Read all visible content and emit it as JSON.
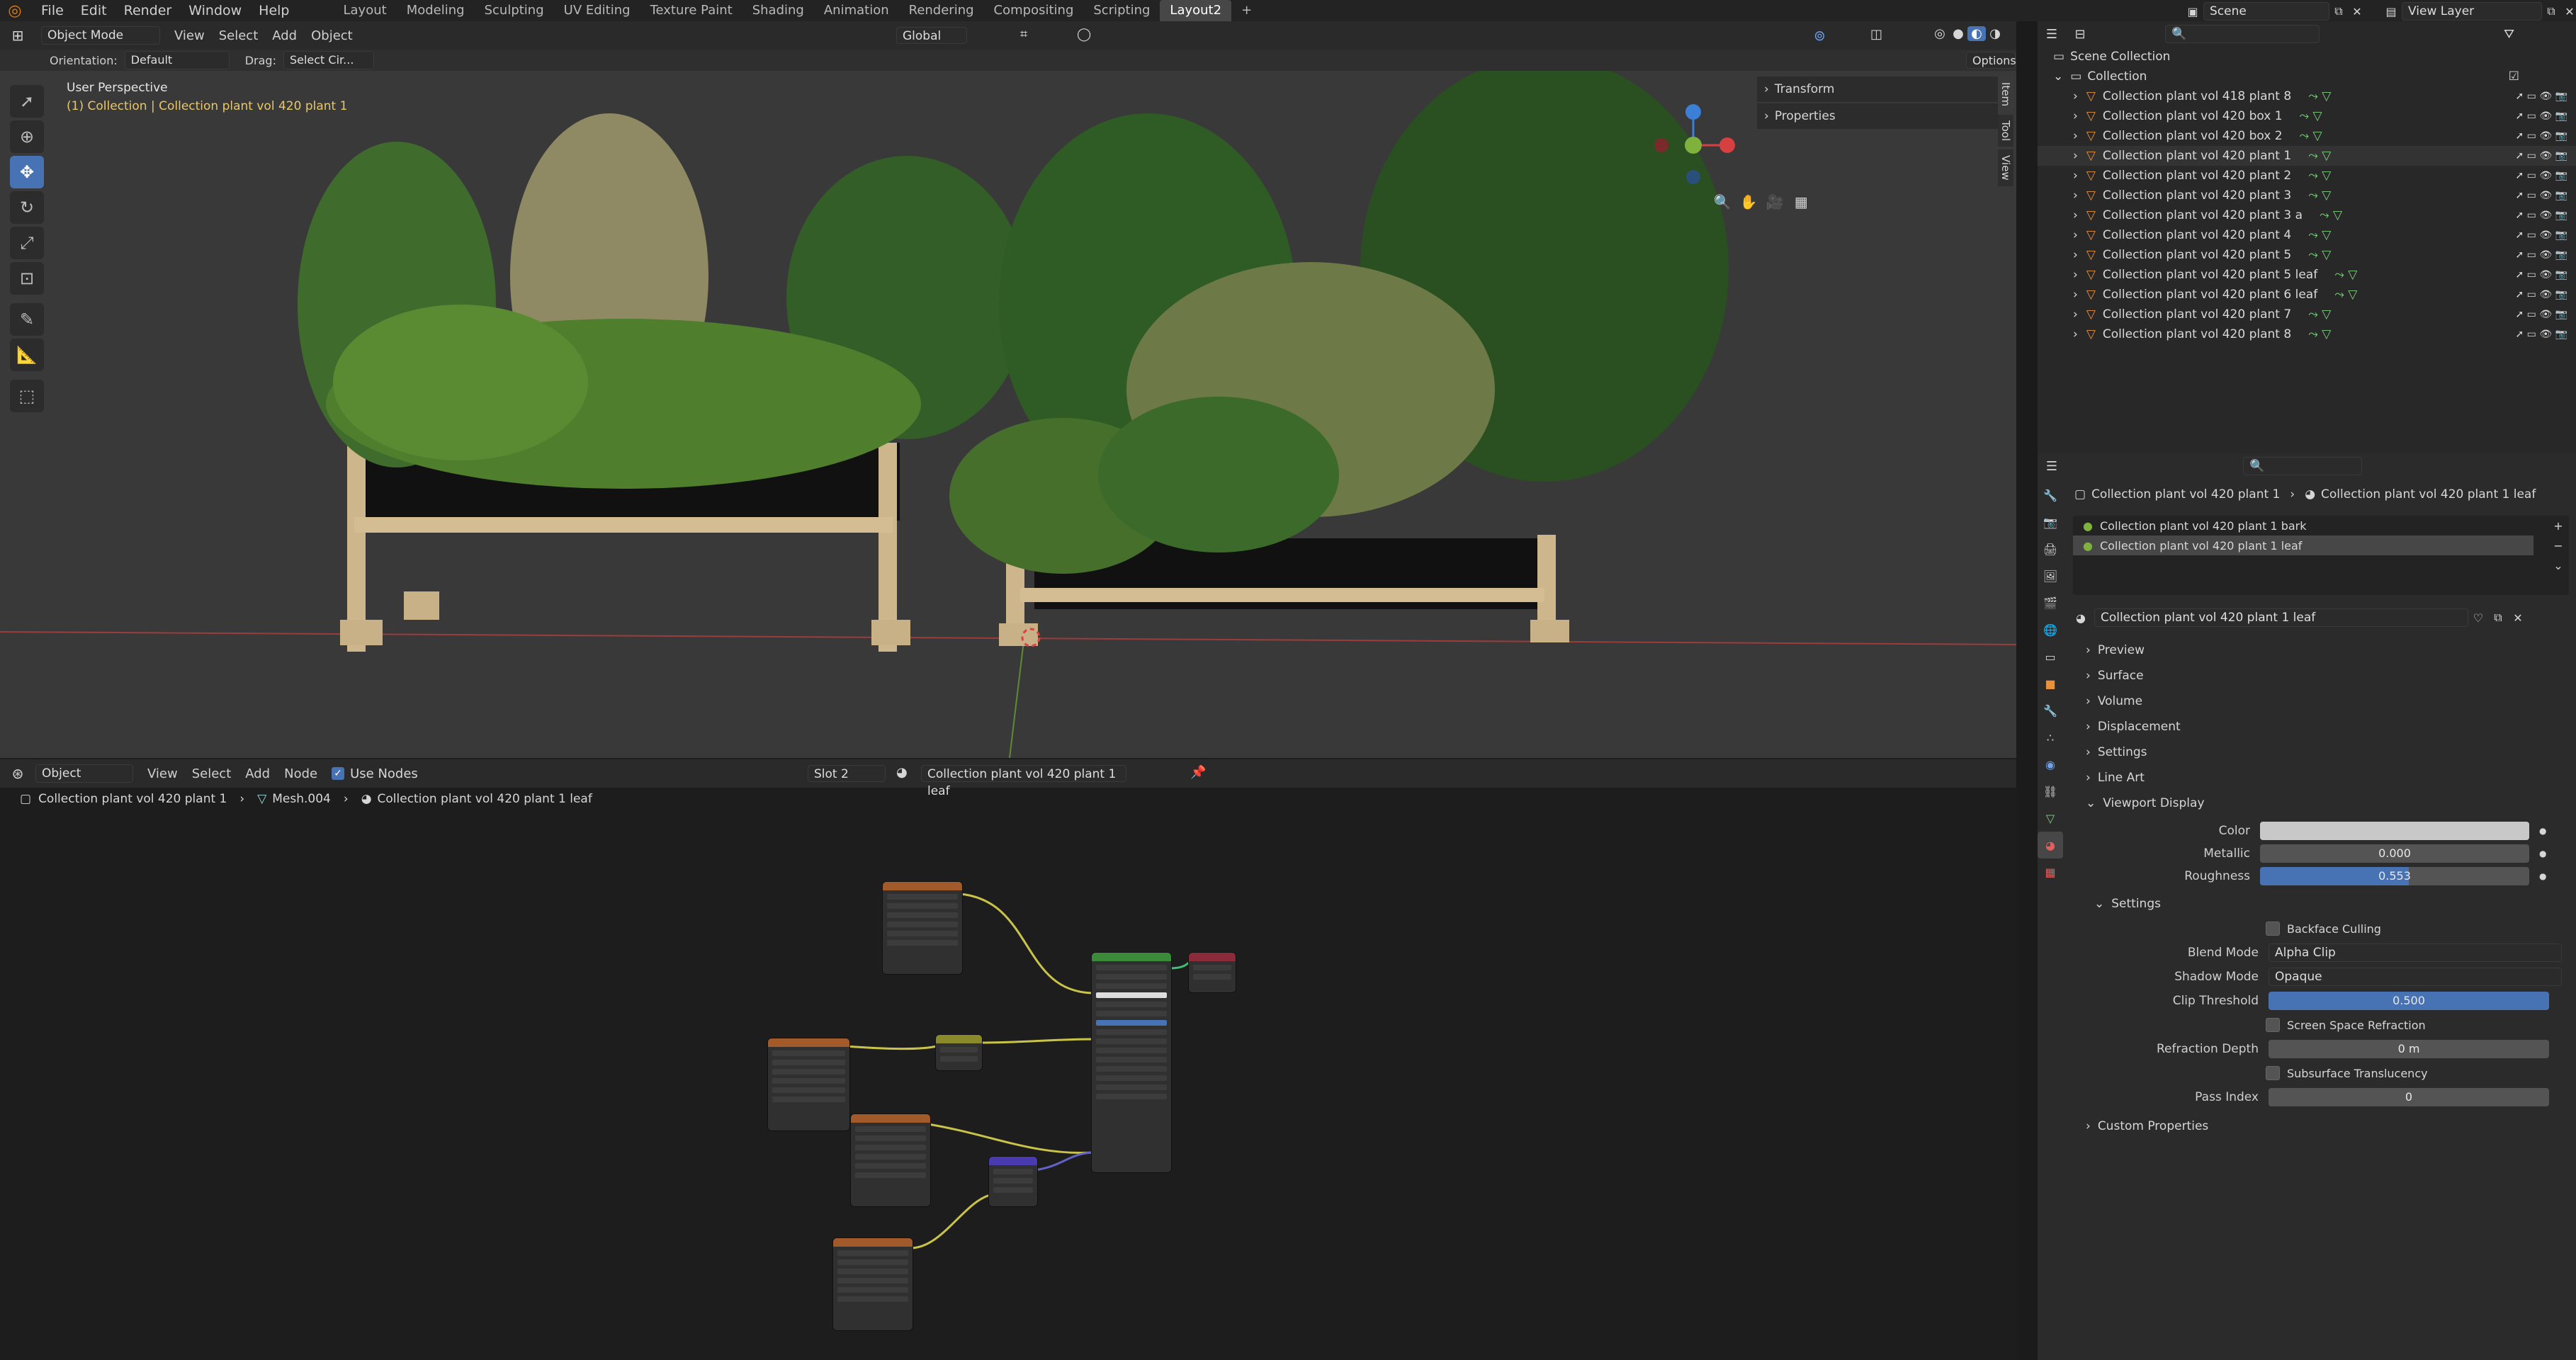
{
  "topbar": {
    "menus": [
      "File",
      "Edit",
      "Render",
      "Window",
      "Help"
    ],
    "workspaces": [
      "Layout",
      "Modeling",
      "Sculpting",
      "UV Editing",
      "Texture Paint",
      "Shading",
      "Animation",
      "Rendering",
      "Compositing",
      "Scripting",
      "Layout2"
    ],
    "active_workspace": "Layout2",
    "add_tab": "+",
    "scene": "Scene",
    "view_layer": "View Layer"
  },
  "viewport": {
    "mode": "Object Mode",
    "menus": [
      "View",
      "Select",
      "Add",
      "Object"
    ],
    "orientation_label": "Orientation:",
    "orientation_value": "Default",
    "drag_label": "Drag:",
    "drag_value": "Select Cir...",
    "transform_orientation": "Global",
    "options": "Options",
    "perspective": "User Perspective",
    "collection_info": "(1) Collection | Collection plant vol 420 plant 1",
    "n_panel": [
      "Transform",
      "Properties"
    ],
    "side_tabs": [
      "Item",
      "Tool",
      "View"
    ],
    "gizmo_axes": [
      "Y",
      "Z",
      "X"
    ]
  },
  "node_editor": {
    "editor_type": "Object",
    "menus": [
      "View",
      "Select",
      "Add",
      "Node"
    ],
    "use_nodes_label": "Use Nodes",
    "slot": "Slot 2",
    "material": "Collection plant vol 420 plant 1 leaf",
    "breadcrumb": [
      "Collection plant vol 420 plant 1",
      "Mesh.004",
      "Collection plant vol 420 plant 1 leaf"
    ]
  },
  "outliner": {
    "root": "Scene Collection",
    "collection": "Collection",
    "items": [
      "Collection plant vol 418 plant 8",
      "Collection plant vol 420 box 1",
      "Collection plant vol 420 box 2",
      "Collection plant vol 420 plant 1",
      "Collection plant vol 420 plant 2",
      "Collection plant vol 420 plant 3",
      "Collection plant vol 420 plant 3 a",
      "Collection plant vol 420 plant 4",
      "Collection plant vol 420 plant 5",
      "Collection plant vol 420 plant 5 leaf",
      "Collection plant vol 420 plant 6 leaf",
      "Collection plant vol 420 plant 7",
      "Collection plant vol 420 plant 8"
    ]
  },
  "properties": {
    "breadcrumb_object": "Collection plant vol 420 plant 1",
    "breadcrumb_material": "Collection plant vol 420 plant 1 leaf",
    "slots": [
      "Collection plant vol 420 plant 1 bark",
      "Collection plant vol 420 plant 1 leaf"
    ],
    "material_name": "Collection plant vol 420 plant 1 leaf",
    "sections": [
      "Preview",
      "Surface",
      "Volume",
      "Displacement",
      "Settings",
      "Line Art"
    ],
    "viewport_display": "Viewport Display",
    "color_label": "Color",
    "metallic_label": "Metallic",
    "metallic_value": "0.000",
    "roughness_label": "Roughness",
    "roughness_value": "0.553",
    "roughness_fraction": 0.553,
    "settings_sub": "Settings",
    "backface_culling": "Backface Culling",
    "blend_mode_label": "Blend Mode",
    "blend_mode_value": "Alpha Clip",
    "shadow_mode_label": "Shadow Mode",
    "shadow_mode_value": "Opaque",
    "clip_threshold_label": "Clip Threshold",
    "clip_threshold_value": "0.500",
    "screen_space_refraction": "Screen Space Refraction",
    "refraction_depth_label": "Refraction Depth",
    "refraction_depth_value": "0 m",
    "subsurface_translucency": "Subsurface Translucency",
    "pass_index_label": "Pass Index",
    "pass_index_value": "0",
    "custom_properties": "Custom Properties"
  },
  "colors": {
    "accent": "#4772b3",
    "active_text": "#e8c76b",
    "x_axis": "#d64040",
    "y_axis": "#7fb13d",
    "z_axis": "#3b7fd6"
  }
}
